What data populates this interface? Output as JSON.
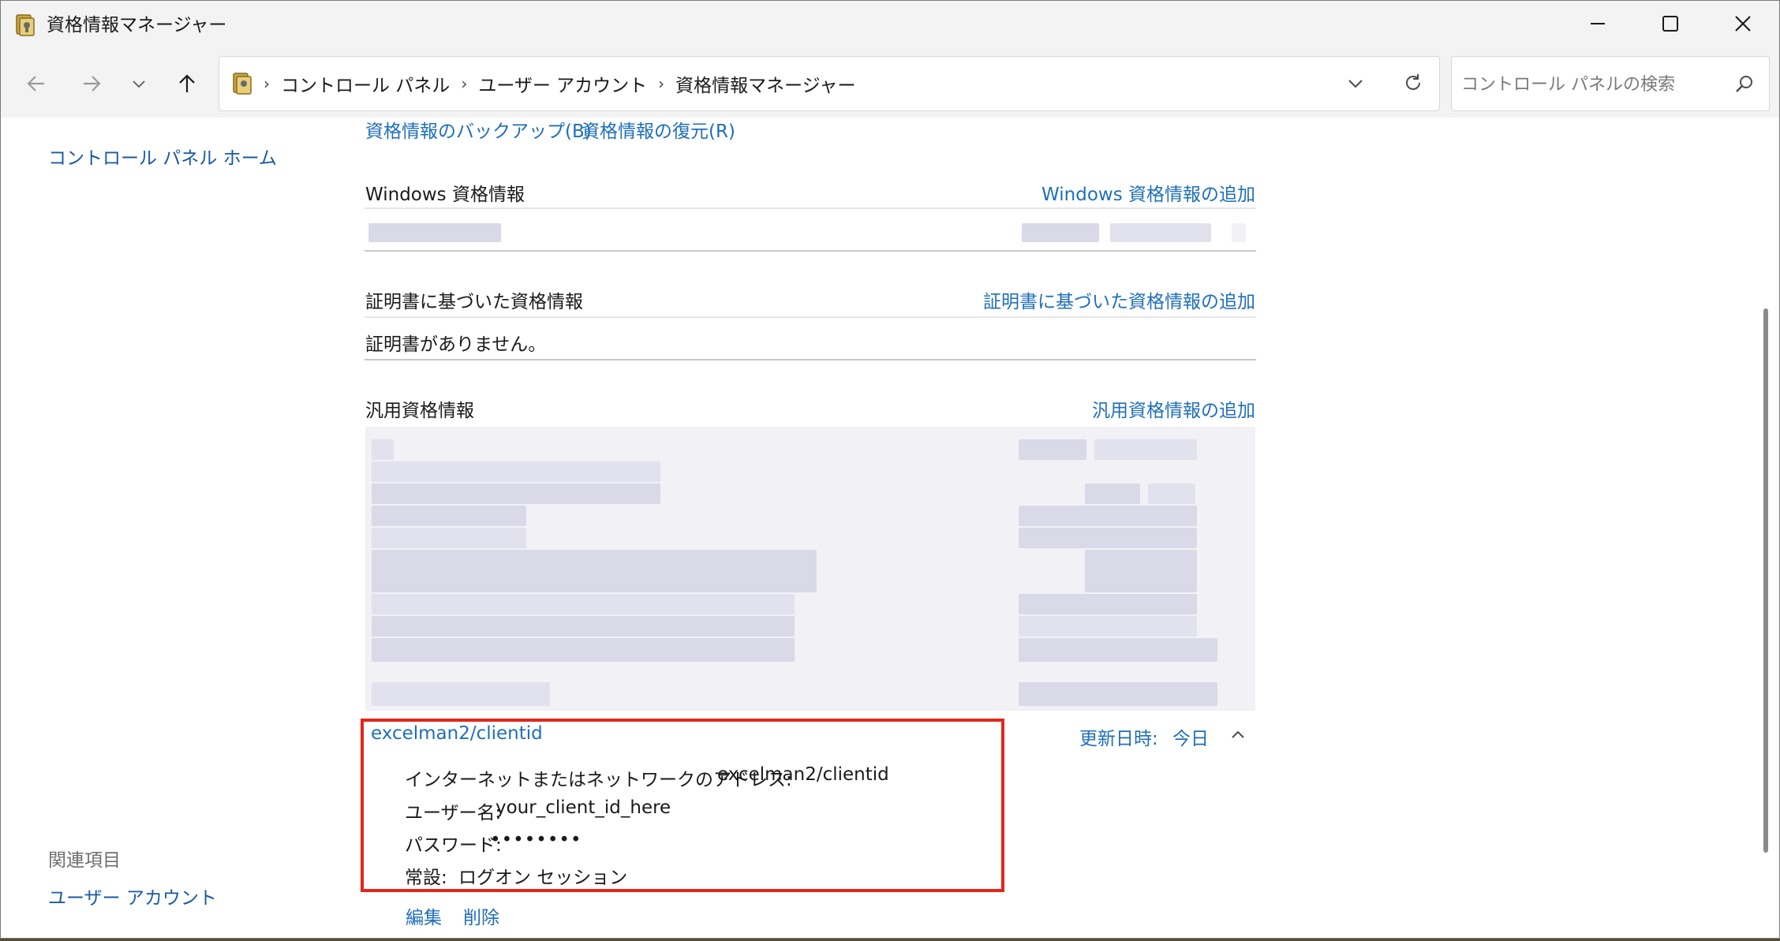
{
  "window": {
    "title": "資格情報マネージャー"
  },
  "address": {
    "breadcrumbs": [
      "コントロール パネル",
      "ユーザー アカウント",
      "資格情報マネージャー"
    ]
  },
  "search": {
    "placeholder": "コントロール パネルの検索"
  },
  "left_pane": {
    "home_link": "コントロール パネル ホーム",
    "related_heading": "関連項目",
    "related_link": "ユーザー アカウント"
  },
  "toolbar": {
    "backup_link": "資格情報のバックアップ(B)",
    "restore_link": "資格情報の復元(R)"
  },
  "sections": {
    "windows": {
      "title": "Windows 資格情報",
      "add_label": "Windows 資格情報の追加"
    },
    "certificate": {
      "title": "証明書に基づいた資格情報",
      "add_label": "証明書に基づいた資格情報の追加",
      "empty_text": "証明書がありません。"
    },
    "generic": {
      "title": "汎用資格情報",
      "add_label": "汎用資格情報の追加"
    }
  },
  "expanded_credential": {
    "name": "excelman2/clientid",
    "modified_label": "更新日時:",
    "modified_value": "今日",
    "address_label": "インターネットまたはネットワークのアドレス:",
    "address_value": "excelman2/clientid",
    "user_label": "ユーザー名:",
    "user_value": "your_client_id_here",
    "password_label": "パスワード:",
    "password_value": "••••••••",
    "persistence_label": "常設:",
    "persistence_value": "ログオン セッション",
    "edit_link": "編集",
    "delete_link": "削除"
  },
  "colors": {
    "link": "#1f6fb8",
    "highlight_box": "#e2261b"
  },
  "icons": [
    "credential-manager-icon",
    "minimize-icon",
    "maximize-icon",
    "close-icon",
    "back-arrow-icon",
    "forward-arrow-icon",
    "recent-chevron-icon",
    "up-arrow-icon",
    "refresh-icon",
    "search-icon",
    "chevron-up-icon"
  ]
}
